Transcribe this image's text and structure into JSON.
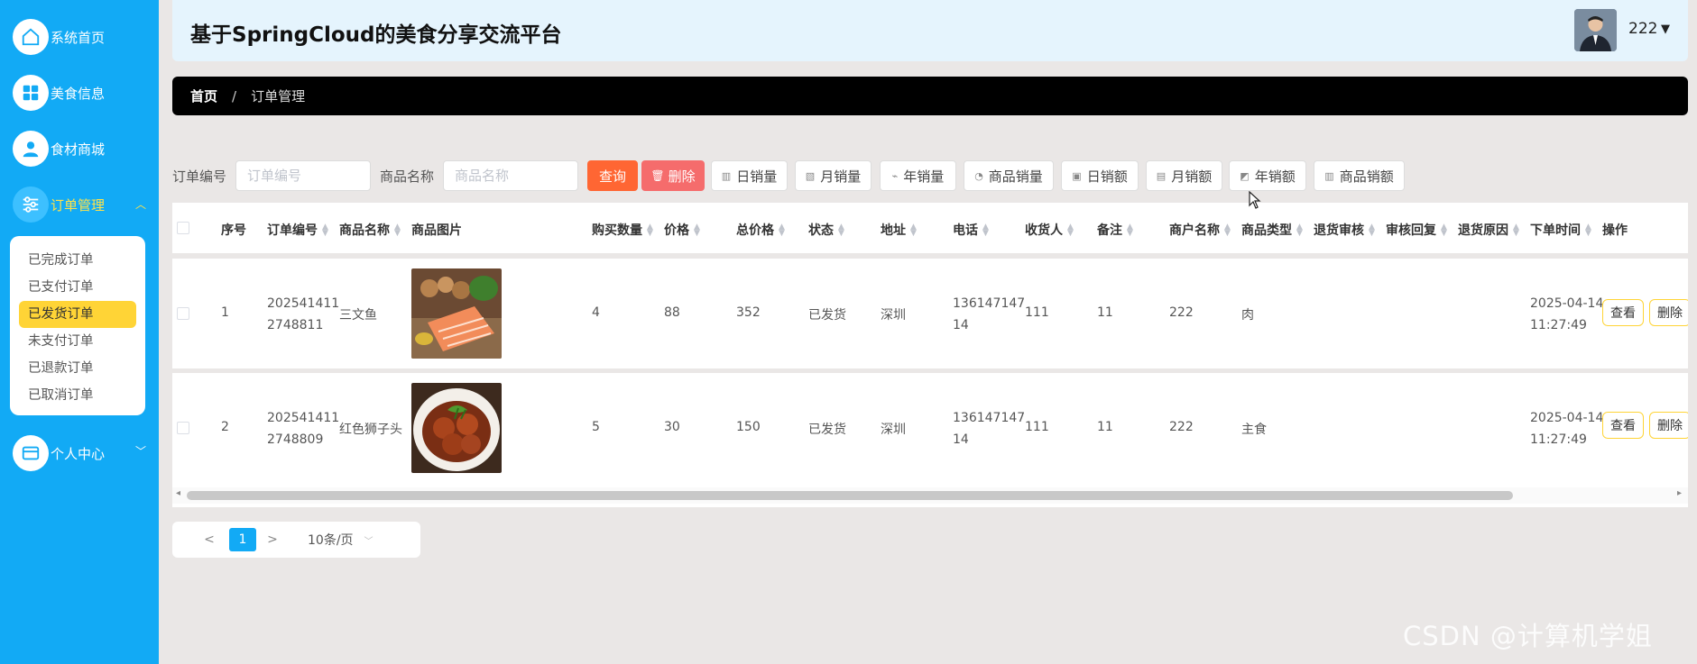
{
  "app": {
    "title": "基于SpringCloud的美食分享交流平台",
    "user_name": "222"
  },
  "sidebar": {
    "items": [
      {
        "label": "系统首页",
        "icon": "home-icon"
      },
      {
        "label": "美食信息",
        "icon": "grid-icon"
      },
      {
        "label": "食材商城",
        "icon": "user-icon"
      },
      {
        "label": "订单管理",
        "icon": "sliders-icon"
      },
      {
        "label": "个人中心",
        "icon": "card-icon"
      }
    ],
    "order_submenu": [
      "已完成订单",
      "已支付订单",
      "已发货订单",
      "未支付订单",
      "已退款订单",
      "已取消订单"
    ]
  },
  "breadcrumb": {
    "home": "首页",
    "separator": "/",
    "current": "订单管理"
  },
  "filters": {
    "order_no_label": "订单编号",
    "order_no_placeholder": "订单编号",
    "product_label": "商品名称",
    "product_placeholder": "商品名称",
    "query_button": "查询",
    "delete_button": "删除",
    "stat_buttons": [
      "日销量",
      "月销量",
      "年销量",
      "商品销量",
      "日销额",
      "月销额",
      "年销额",
      "商品销额"
    ]
  },
  "table": {
    "columns": [
      "序号",
      "订单编号",
      "商品名称",
      "商品图片",
      "购买数量",
      "价格",
      "总价格",
      "状态",
      "地址",
      "电话",
      "收货人",
      "备注",
      "商户名称",
      "商品类型",
      "退货审核",
      "审核回复",
      "退货原因",
      "下单时间",
      "操作"
    ],
    "rows": [
      {
        "index": "1",
        "order_no": [
          "202541411",
          "2748811"
        ],
        "product": "三文鱼",
        "qty": "4",
        "price": "88",
        "total": "352",
        "status": "已发货",
        "address": "深圳",
        "phone": [
          "136147147",
          "14"
        ],
        "receiver": "111",
        "note": "11",
        "merchant": "222",
        "type": "肉",
        "time": [
          "2025-04-14",
          "11:27:49"
        ]
      },
      {
        "index": "2",
        "order_no": [
          "202541411",
          "2748809"
        ],
        "product": "红色狮子头",
        "qty": "5",
        "price": "30",
        "total": "150",
        "status": "已发货",
        "address": "深圳",
        "phone": [
          "136147147",
          "14"
        ],
        "receiver": "111",
        "note": "11",
        "merchant": "222",
        "type": "主食",
        "time": [
          "2025-04-14",
          "11:27:49"
        ]
      }
    ],
    "view_label": "查看",
    "delete_label": "删除"
  },
  "pagination": {
    "prev": "<",
    "current_page": "1",
    "next": ">",
    "page_size": "10条/页"
  },
  "watermark": "CSDN @计算机学姐",
  "colors": {
    "sidebar": "#12aaf5",
    "active_menu": "#ffd436",
    "query_button": "#ff6633",
    "delete_button": "#f56c6c",
    "header_bg": "#e5f4fd"
  }
}
